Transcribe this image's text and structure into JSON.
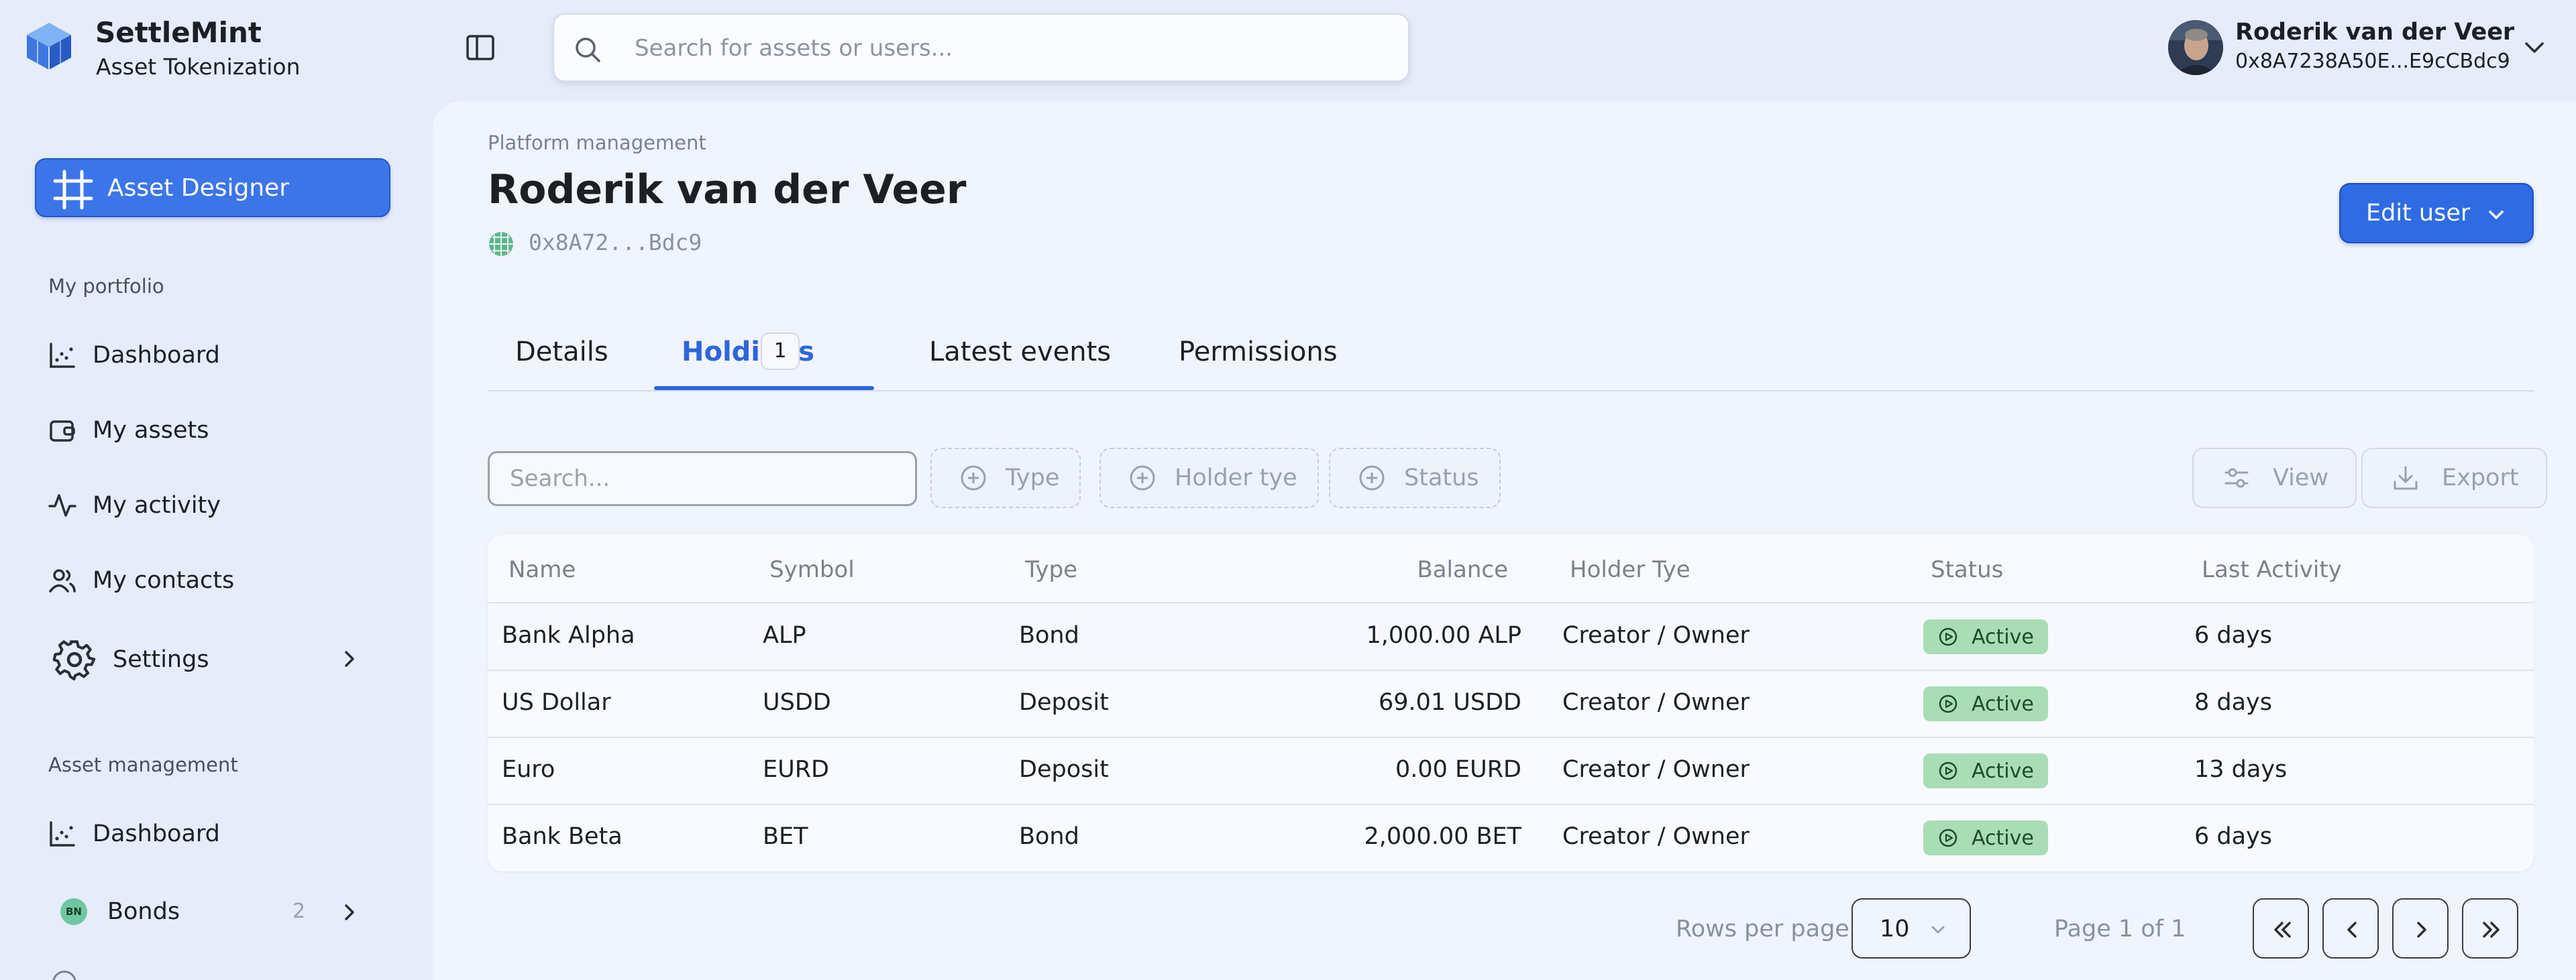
{
  "brand": {
    "title": "SettleMint",
    "subtitle": "Asset Tokenization",
    "icon": "cube-logo"
  },
  "search": {
    "placeholder": "Search for assets or users..."
  },
  "user": {
    "name": "Roderik van der Veer",
    "address": "0x8A7238A50E...E9cCBdc9"
  },
  "sidebar": {
    "designer_label": "Asset Designer",
    "portfolio_section": "My portfolio",
    "portfolio_items": [
      {
        "label": "Dashboard",
        "icon": "chart-icon"
      },
      {
        "label": "My assets",
        "icon": "wallet-icon"
      },
      {
        "label": "My activity",
        "icon": "activity-icon"
      },
      {
        "label": "My contacts",
        "icon": "users-icon"
      },
      {
        "label": "Settings",
        "icon": "gear-icon"
      }
    ],
    "management_section": "Asset management",
    "management_items": [
      {
        "label": "Dashboard",
        "icon": "chart-icon"
      },
      {
        "label": "Bonds",
        "icon": "bond-icon",
        "badge_text": "BN",
        "count": "2"
      }
    ]
  },
  "page": {
    "breadcrumb": "Platform management",
    "title": "Roderik van der Veer",
    "address": "0x8A72...Bdc9",
    "edit_label": "Edit user"
  },
  "tabs": [
    {
      "label": "Details"
    },
    {
      "label": "Holdings",
      "count": "1",
      "active": true
    },
    {
      "label": "Latest events"
    },
    {
      "label": "Permissions"
    }
  ],
  "toolbar": {
    "search_placeholder": "Search...",
    "filters": [
      "Type",
      "Holder tye",
      "Status"
    ],
    "view_label": "View",
    "export_label": "Export"
  },
  "table": {
    "columns": [
      "Name",
      "Symbol",
      "Type",
      "Balance",
      "Holder Tye",
      "Status",
      "Last Activity"
    ],
    "rows": [
      {
        "name": "Bank Alpha",
        "symbol": "ALP",
        "type": "Bond",
        "balance": "1,000.00 ALP",
        "holder": "Creator / Owner",
        "status": "Active",
        "last": "6 days"
      },
      {
        "name": "US Dollar",
        "symbol": "USDD",
        "type": "Deposit",
        "balance": "69.01 USDD",
        "holder": "Creator / Owner",
        "status": "Active",
        "last": "8 days"
      },
      {
        "name": "Euro",
        "symbol": "EURD",
        "type": "Deposit",
        "balance": "0.00 EURD",
        "holder": "Creator / Owner",
        "status": "Active",
        "last": "13 days"
      },
      {
        "name": "Bank Beta",
        "symbol": "BET",
        "type": "Bond",
        "balance": "2,000.00 BET",
        "holder": "Creator / Owner",
        "status": "Active",
        "last": "6 days"
      }
    ]
  },
  "pagination": {
    "rows_label": "Rows per page",
    "rows_value": "10",
    "page_info": "Page 1 of 1"
  },
  "colors": {
    "accent": "#2d66dc",
    "active_badge": "#a9ddb6",
    "background": "#e6ecfa"
  }
}
